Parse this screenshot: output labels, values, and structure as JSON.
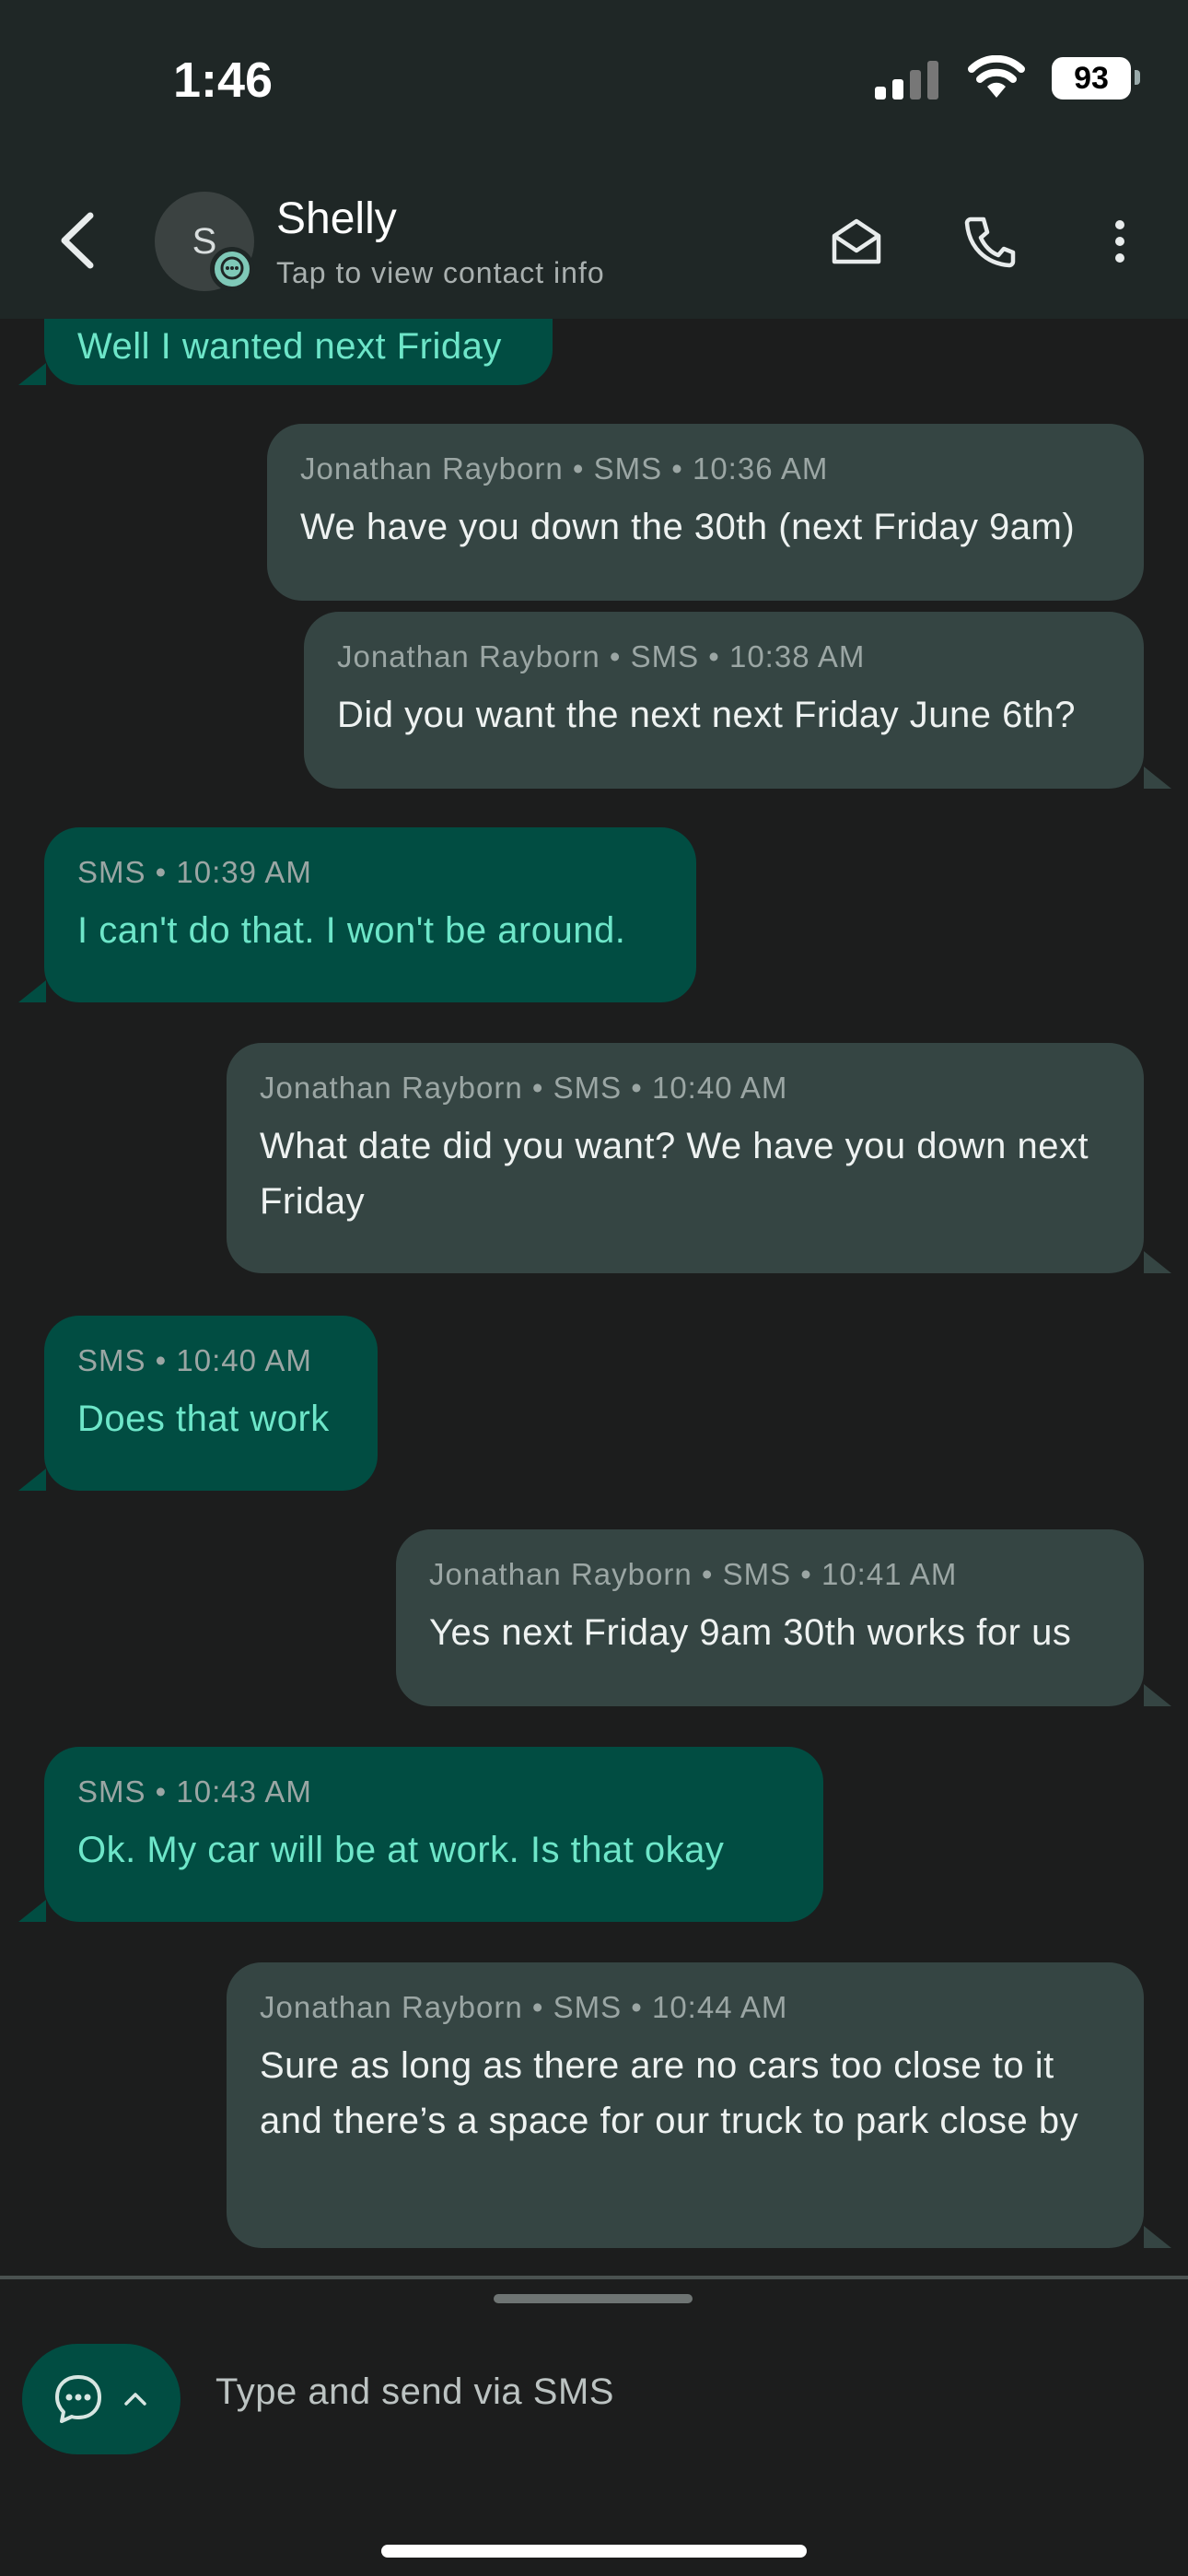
{
  "status_bar": {
    "time": "1:46",
    "battery": "93"
  },
  "header": {
    "avatar_initial": "S",
    "contact_name": "Shelly",
    "contact_subtitle": "Tap to view contact info"
  },
  "messages": [
    {
      "dir": "in",
      "meta": "",
      "text": "Well I wanted next Friday"
    },
    {
      "dir": "out",
      "meta": "Jonathan Rayborn • SMS • 10:36 AM",
      "text": "We have you down the 30th (next Friday 9am)"
    },
    {
      "dir": "out",
      "meta": "Jonathan Rayborn • SMS • 10:38 AM",
      "text": "Did you want the next next Friday June 6th?"
    },
    {
      "dir": "in",
      "meta": "SMS • 10:39 AM",
      "text": "I can't do that.  I won't be around."
    },
    {
      "dir": "out",
      "meta": "Jonathan Rayborn • SMS • 10:40 AM",
      "text": "What date did you want? We have you down next Friday"
    },
    {
      "dir": "in",
      "meta": "SMS • 10:40 AM",
      "text": "Does that work"
    },
    {
      "dir": "out",
      "meta": "Jonathan Rayborn • SMS • 10:41 AM",
      "text": "Yes next Friday 9am 30th works for us"
    },
    {
      "dir": "in",
      "meta": "SMS • 10:43 AM",
      "text": "Ok.   My car will be at work.  Is that okay"
    },
    {
      "dir": "out",
      "meta": "Jonathan Rayborn • SMS • 10:44 AM",
      "text": "Sure as long as there are no cars too close to it and there’s a space for our truck to park close by"
    }
  ],
  "composer": {
    "placeholder": "Type and send via SMS"
  },
  "icons": {
    "back": "chevron-left-icon",
    "email": "envelope-icon",
    "call": "phone-icon",
    "more": "more-vertical-icon",
    "compose": "chat-bubble-icon",
    "expand": "chevron-up-icon"
  }
}
